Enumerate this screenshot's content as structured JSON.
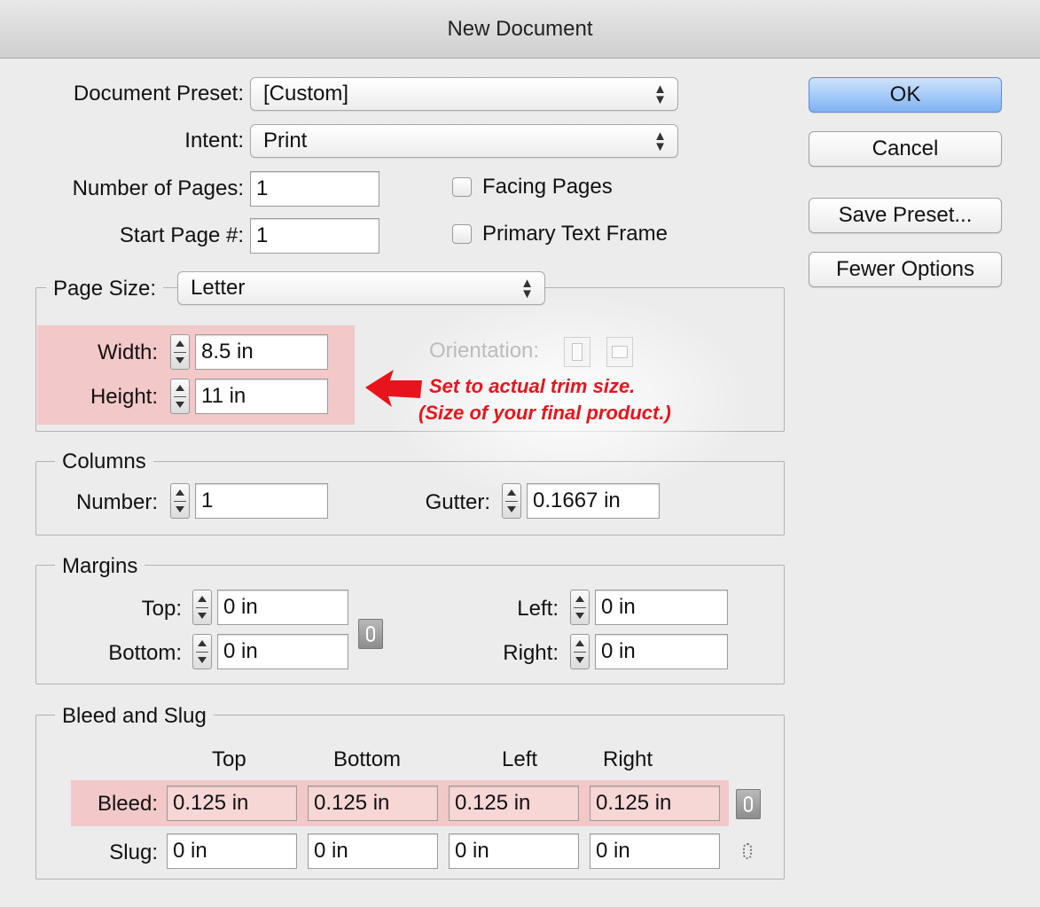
{
  "window": {
    "title": "New Document"
  },
  "top": {
    "document_preset_label": "Document Preset:",
    "document_preset_value": "[Custom]",
    "intent_label": "Intent:",
    "intent_value": "Print",
    "number_of_pages_label": "Number of Pages:",
    "number_of_pages_value": "1",
    "start_page_label": "Start Page #:",
    "start_page_value": "1",
    "facing_pages_label": "Facing Pages",
    "facing_pages_checked": false,
    "primary_text_frame_label": "Primary Text Frame",
    "primary_text_frame_checked": false
  },
  "buttons": {
    "ok": "OK",
    "cancel": "Cancel",
    "save_preset": "Save Preset...",
    "fewer_options": "Fewer Options"
  },
  "page_size": {
    "label": "Page Size:",
    "value": "Letter",
    "width_label": "Width:",
    "width_value": "8.5 in",
    "height_label": "Height:",
    "height_value": "11 in",
    "orientation_label": "Orientation:"
  },
  "annotation": {
    "line1": "Set to actual trim size.",
    "line2": "(Size of your final product.)",
    "color": "#e8141c"
  },
  "columns": {
    "title": "Columns",
    "number_label": "Number:",
    "number_value": "1",
    "gutter_label": "Gutter:",
    "gutter_value": "0.1667 in"
  },
  "margins": {
    "title": "Margins",
    "top_label": "Top:",
    "top_value": "0 in",
    "bottom_label": "Bottom:",
    "bottom_value": "0 in",
    "left_label": "Left:",
    "left_value": "0 in",
    "right_label": "Right:",
    "right_value": "0 in"
  },
  "bleed_slug": {
    "title": "Bleed and Slug",
    "headers": [
      "Top",
      "Bottom",
      "Left",
      "Right"
    ],
    "bleed_label": "Bleed:",
    "bleed_values": [
      "0.125 in",
      "0.125 in",
      "0.125 in",
      "0.125 in"
    ],
    "slug_label": "Slug:",
    "slug_values": [
      "0 in",
      "0 in",
      "0 in",
      "0 in"
    ]
  },
  "highlight_color": "#f3c8c8"
}
